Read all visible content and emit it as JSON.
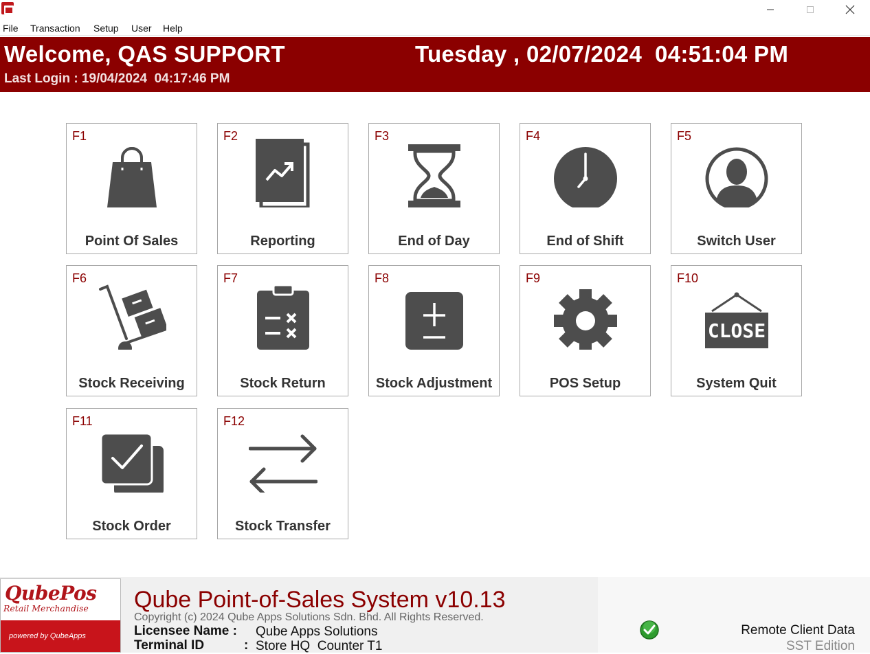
{
  "window": {
    "controls": {
      "minimize": "—",
      "maximize": "☐",
      "close": "✕"
    }
  },
  "menu": [
    "File",
    "Transaction",
    "Setup",
    "User",
    "Help"
  ],
  "header": {
    "welcome": "Welcome, QAS SUPPORT",
    "datetime": "Tuesday , 02/07/2024  04:51:04 PM",
    "last_login": "Last Login : 19/04/2024  04:17:46 PM"
  },
  "tiles": [
    {
      "key": "F1",
      "label": "Point Of Sales",
      "icon": "shopping-bag-icon"
    },
    {
      "key": "F2",
      "label": "Reporting",
      "icon": "report-chart-icon"
    },
    {
      "key": "F3",
      "label": "End of Day",
      "icon": "hourglass-icon"
    },
    {
      "key": "F4",
      "label": "End of Shift",
      "icon": "clock-icon"
    },
    {
      "key": "F5",
      "label": "Switch User",
      "icon": "user-icon"
    },
    {
      "key": "F6",
      "label": "Stock Receiving",
      "icon": "hand-truck-icon"
    },
    {
      "key": "F7",
      "label": "Stock Return",
      "icon": "clipboard-icon"
    },
    {
      "key": "F8",
      "label": "Stock Adjustment",
      "icon": "plus-minus-icon"
    },
    {
      "key": "F9",
      "label": "POS Setup",
      "icon": "gear-icon"
    },
    {
      "key": "F10",
      "label": "System Quit",
      "icon": "close-sign-icon",
      "sign_text": "CLOSE"
    },
    {
      "key": "F11",
      "label": "Stock Order",
      "icon": "checkbox-icon"
    },
    {
      "key": "F12",
      "label": "Stock Transfer",
      "icon": "transfer-arrows-icon"
    }
  ],
  "footer": {
    "logo_brand": "QubePos",
    "logo_tagline": "Retail Merchandise",
    "powered_by": "powered by QubeApps",
    "system_title": "Qube Point-of-Sales System v10.13",
    "copyright": "Copyright (c) 2024 Qube Apps Solutions Sdn. Bhd. All Rights Reserved.",
    "licensee_label": "Licensee Name : ",
    "licensee_value": "Qube Apps Solutions",
    "terminal_label": "Terminal ID",
    "terminal_colon": ":",
    "terminal_value": "Store HQ  Counter T1",
    "status_icon": "green-check-icon",
    "remote_label": "Remote Client Data",
    "edition": "SST Edition"
  },
  "colors": {
    "header_bg": "#8b0000",
    "key_text": "#8b0000",
    "icon": "#4d4d4d",
    "brand_red": "#c8141b"
  }
}
